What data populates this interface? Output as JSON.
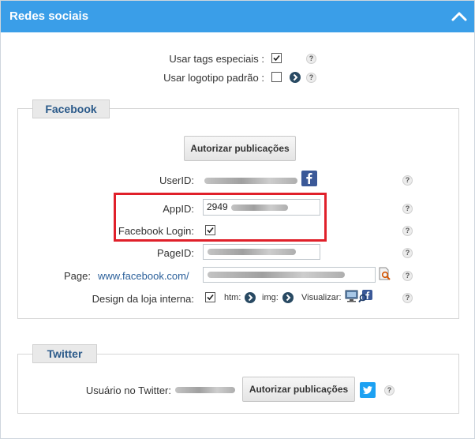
{
  "header": {
    "title": "Redes sociais"
  },
  "general": {
    "special_tags_label": "Usar tags especiais :",
    "special_tags_checked": true,
    "default_logo_label": "Usar logotipo padrão :",
    "default_logo_checked": false
  },
  "facebook": {
    "legend": "Facebook",
    "authorize_button": "Autorizar publicações",
    "userid_label": "UserID:",
    "appid_label": "AppID:",
    "appid_value": "2949",
    "login_label": "Facebook Login:",
    "login_checked": true,
    "pageid_label": "PageID:",
    "page_label": "Page:",
    "page_url_prefix": "www.facebook.com/",
    "design_label": "Design da loja interna:",
    "design_checked": true,
    "htm_label": "htm:",
    "img_label": "img:",
    "visualize_label": "Visualizar:"
  },
  "twitter": {
    "legend": "Twitter",
    "user_label": "Usuário no Twitter:",
    "authorize_button": "Autorizar publicações"
  },
  "help_glyph": "?",
  "colors": {
    "header": "#3a9ee8",
    "highlight": "#e0202a",
    "facebook": "#3b5998",
    "twitter": "#1da1f2"
  }
}
